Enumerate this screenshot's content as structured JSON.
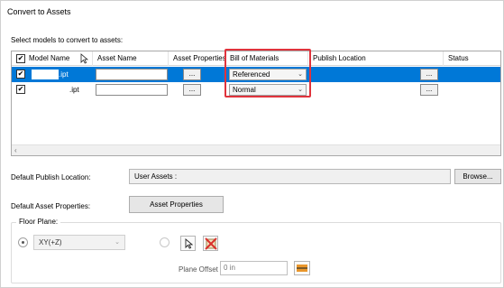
{
  "window": {
    "title": "Convert to Assets"
  },
  "grid": {
    "instruction": "Select models to convert to assets:",
    "columns": [
      "Model Name",
      "Asset Name",
      "Asset Properties",
      "Bill of Materials",
      "Publish Location",
      "Status"
    ],
    "header_checkbox": "✔",
    "rows": [
      {
        "checkbox": "✔",
        "model_name": ".ipt",
        "asset_name": "",
        "asset_properties_button": "...",
        "bill_of_materials": "Referenced",
        "publish_location_button": "...",
        "status": "",
        "selected": true
      },
      {
        "checkbox": "✔",
        "model_name": ".ipt",
        "asset_name": "",
        "asset_properties_button": "...",
        "bill_of_materials": "Normal",
        "publish_location_button": "...",
        "status": "",
        "selected": false
      }
    ],
    "scroll_left_glyph": "‹"
  },
  "publish": {
    "label": "Default Publish Location:",
    "value": "User Assets :",
    "browse_label": "Browse..."
  },
  "asset_props": {
    "label": "Default Asset Properties:",
    "button_label": "Asset Properties"
  },
  "floor_plane": {
    "label": "Floor Plane:",
    "plane_value": "XY(+Z)",
    "offset_label": "Plane Offset",
    "offset_value": "0 in"
  },
  "colors": {
    "selection": "#0078d7",
    "highlight": "#e0333c",
    "tool_red": "#d9302c",
    "tool_orange": "#e9962b"
  },
  "icons": [
    "chevron-down-icon",
    "cursor-select-icon",
    "clear-selection-icon",
    "measure-icon",
    "mouse-pointer-icon"
  ]
}
